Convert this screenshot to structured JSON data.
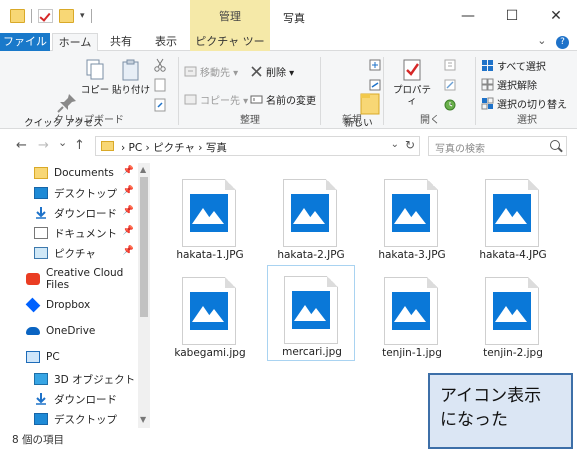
{
  "window": {
    "title": "写真",
    "context_tab": "管理",
    "controls": {
      "minimize": "—",
      "maximize": "☐",
      "close": "✕"
    }
  },
  "ribbon_tabs": {
    "file": "ファイル",
    "home": "ホーム",
    "share": "共有",
    "view": "表示",
    "picture_tools": "ピクチャ ツール",
    "expand": "⌄",
    "help": "?"
  },
  "ribbon": {
    "clipboard": {
      "pin_label": "クイック アクセス\nにピン留めする",
      "copy": "コピー",
      "paste": "貼り付け",
      "group": "クリップボード"
    },
    "organize": {
      "move_to": "移動先 ▾",
      "copy_to": "コピー先 ▾",
      "delete": "削除 ▾",
      "rename": "名前の変更",
      "group": "整理"
    },
    "new": {
      "new_folder": "新しい\nフォルダー",
      "group": "新規"
    },
    "open": {
      "properties": "プロパティ",
      "group": "開く"
    },
    "select": {
      "select_all": "すべて選択",
      "select_none": "選択解除",
      "invert": "選択の切り替え",
      "group": "選択"
    }
  },
  "address": {
    "back": "←",
    "forward": "→",
    "recent": "⌄",
    "up": "↑",
    "crumbs": "›  PC  ›  ピクチャ  ›  写真",
    "search_placeholder": "写真の検索"
  },
  "nav_pane": {
    "items": [
      {
        "label": "Documents",
        "icon": "folder-icon",
        "pinned": true
      },
      {
        "label": "デスクトップ",
        "icon": "desktop-icon",
        "pinned": true
      },
      {
        "label": "ダウンロード",
        "icon": "download-icon",
        "pinned": true
      },
      {
        "label": "ドキュメント",
        "icon": "document-icon",
        "pinned": true
      },
      {
        "label": "ピクチャ",
        "icon": "pictures-icon",
        "pinned": true
      },
      {
        "label": "Creative Cloud Files",
        "icon": "creative-cloud-icon",
        "pinned": false
      },
      {
        "label": "Dropbox",
        "icon": "dropbox-icon",
        "pinned": false
      },
      {
        "label": "OneDrive",
        "icon": "onedrive-icon",
        "pinned": false
      },
      {
        "label": "PC",
        "icon": "pc-icon",
        "pinned": false
      },
      {
        "label": "3D オブジェクト",
        "icon": "3d-objects-icon",
        "pinned": false
      },
      {
        "label": "ダウンロード",
        "icon": "download-icon",
        "pinned": false
      },
      {
        "label": "デスクトップ",
        "icon": "desktop-icon",
        "pinned": false
      }
    ],
    "pin_glyph": "📌"
  },
  "files": [
    {
      "name": "hakata-1.JPG"
    },
    {
      "name": "hakata-2.JPG"
    },
    {
      "name": "hakata-3.JPG"
    },
    {
      "name": "hakata-4.JPG"
    },
    {
      "name": "kabegami.jpg"
    },
    {
      "name": "mercari.jpg"
    },
    {
      "name": "tenjin-1.jpg"
    },
    {
      "name": "tenjin-2.jpg"
    }
  ],
  "status": {
    "count": "8 個の項目"
  },
  "callout": {
    "line1": "アイコン表示",
    "line2": "になった"
  },
  "colors": {
    "accent": "#1979ca",
    "context": "#f5e9a8",
    "thumb_blue": "#0a78d8",
    "callout_bg": "#dbe6f4",
    "callout_border": "#3d6fa8"
  }
}
